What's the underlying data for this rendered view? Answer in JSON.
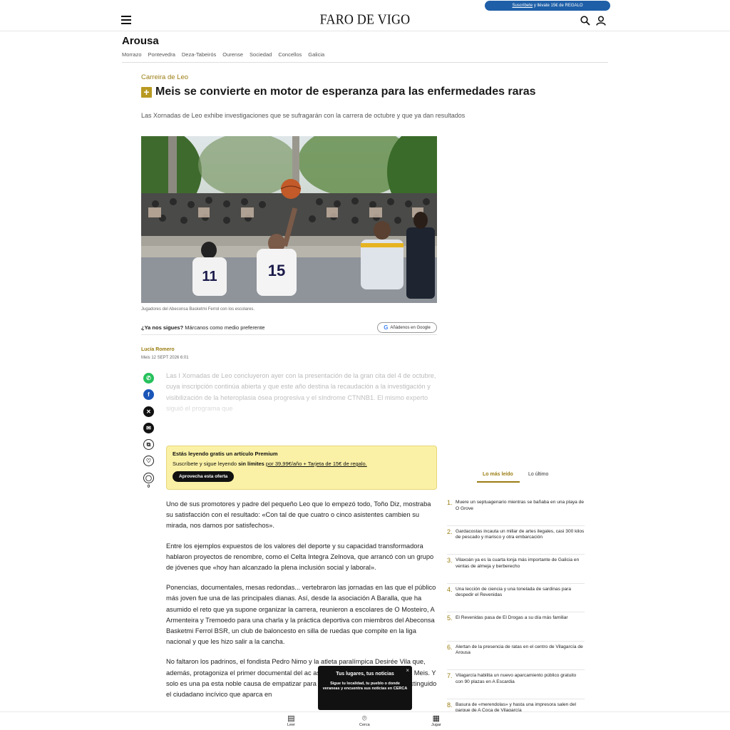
{
  "header": {
    "logo": "FARO DE VIGO",
    "promo_link": "Suscríbete",
    "promo_rest": " y llévate 15€ de REGALO"
  },
  "section": {
    "title": "Arousa",
    "subnav": [
      "Morrazo",
      "Pontevedra",
      "Deza-Tabeirós",
      "Ourense",
      "Sociedad",
      "Concellos",
      "Galicia"
    ]
  },
  "article": {
    "kicker": "Carreira de Leo",
    "headline": "Meis se convierte en motor de esperanza para las enfermedades raras",
    "standfirst": "Las Xornadas de Leo exhibe investigaciones que se sufragarán con la carrera de octubre y que ya dan resultados",
    "caption": "Jugadores del Abeconsa Basketmi Ferrol con los escolares.",
    "follow_bold": "¿Ya nos sigues?",
    "follow_text": " Márcanos como medio preferente",
    "google_button": "Añádenos en Google",
    "author": "Lucía Romero",
    "date": "Meis 12 SEPT 2026 6:01",
    "faded_text": "Las I Xornadas de Leo concluyeron ayer con la presentación de la gran cita del 4 de octubre, cuya inscripción continúa abierta y que este año destina la recaudación a la investigación y visibilización de la heteroplasia ósea progresiva y el síndrome CTNNB1. El mismo experto siguió el programa que",
    "comment_count": "0",
    "paragraphs": [
      "Uno de sus promotores y padre del pequeño Leo que lo empezó todo, Toño Diz, mostraba su satisfacción con el resultado: «Con tal de que cuatro o cinco asistentes cambien su mirada, nos damos por satisfechos».",
      "Entre los ejemplos expuestos de los valores del deporte y su capacidad transformadora hablaron proyectos de renombre, como el Celta Integra Zelnova, que arrancó con un grupo de jóvenes que «hoy han alcanzado la plena inclusión social y laboral».",
      "Ponencias, documentales, mesas redondas... vertebraron las jornadas en las que el público más joven fue una de las principales dianas. Así, desde la asociación A Baralla, que ha asumido el reto que ya supone organizar la carrera, reunieron a escolares de O Mosteiro, A Armenteira y Tremoedo para una charla y la práctica deportiva con miembros del Abeconsa Basketmi Ferrol BSR, un club de baloncesto en silla de ruedas que compite en la liga nacional y que les hizo salir a la cancha.",
      "No faltaron los padrinos, el fondista Pedro Nimo y la atleta paralímpica Desirée Vila que, además, protagoniza el primer documental del ac                                        as de vivir», y que se pudo ver en Meis. Y solo es una pa                                        esta noble causa de empatizar para avanzar, pues, com                                        , ni se ha extinguido el ciudadano incívico que aparca en"
    ]
  },
  "premium": {
    "title": "Estás leyendo gratis un artículo Premium",
    "line_start": "Suscríbete y sigue leyendo ",
    "line_bold": "sin límites",
    "line_link": "por 39,99€/año + Tarjeta de 15€ de regalo.",
    "button": "Aprovecha esta oferta"
  },
  "sidebar": {
    "tab_active": "Lo más leído",
    "tab_inactive": "Lo último",
    "items": [
      {
        "num": "1.",
        "text": "Muere un septuagenario mientras se bañaba en una playa de O Grove"
      },
      {
        "num": "2.",
        "text": "Gardacostas incauta un millar de artes ilegales, casi 300 kilos de pescado y marisco y otra embarcación"
      },
      {
        "num": "3.",
        "text": "Vilaxoán ya es la cuarta lonja más importante de Galicia en ventas de almeja y berberecho"
      },
      {
        "num": "4.",
        "text": "Una lección de ciencia y una tonelada de sardinas para despedir el Revenidas"
      },
      {
        "num": "5.",
        "text": "El Revenidas pasa de El Drogas a su día más familiar"
      },
      {
        "num": "6.",
        "text": "Alertan de la presencia de ratas en el centro de Vilagarcía de Arousa"
      },
      {
        "num": "7.",
        "text": "Vilagarcía habilita un nuevo aparcamiento público gratuito con 90 plazas en A Escardia"
      },
      {
        "num": "8.",
        "text": "Basura de «merendolas» y hasta una impresora salen del parque de A Coca de Vilagarcía"
      }
    ]
  },
  "popup": {
    "title": "Tus lugares, tus noticias",
    "body": "Sigue tu localidad, tu pueblo o donde veraneas y encuentra sus noticias en CERCA",
    "close": "×"
  },
  "bottom_nav": {
    "leer": "Leer",
    "cerca": "Cerca",
    "jugar": "Jugar"
  },
  "colors": {
    "accent": "#9a7d12",
    "promo": "#1e5fa8",
    "premium_bg": "#fbf1a6"
  }
}
